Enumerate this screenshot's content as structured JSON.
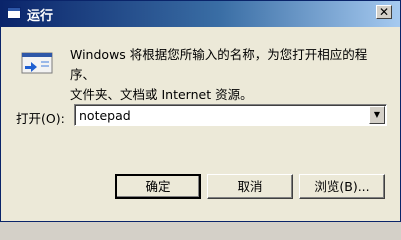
{
  "window": {
    "title": "运行",
    "icon": "run-icon",
    "close_label": "✕"
  },
  "dialog": {
    "description_line1": "Windows 将根据您所输入的名称，为您打开相应的程序、",
    "description_line2": "文件夹、文档或 Internet 资源。",
    "open_label": "打开(O):",
    "open_value": "notepad",
    "combo_arrow": "▼"
  },
  "buttons": {
    "ok": "确定",
    "cancel": "取消",
    "browse": "浏览(B)..."
  }
}
